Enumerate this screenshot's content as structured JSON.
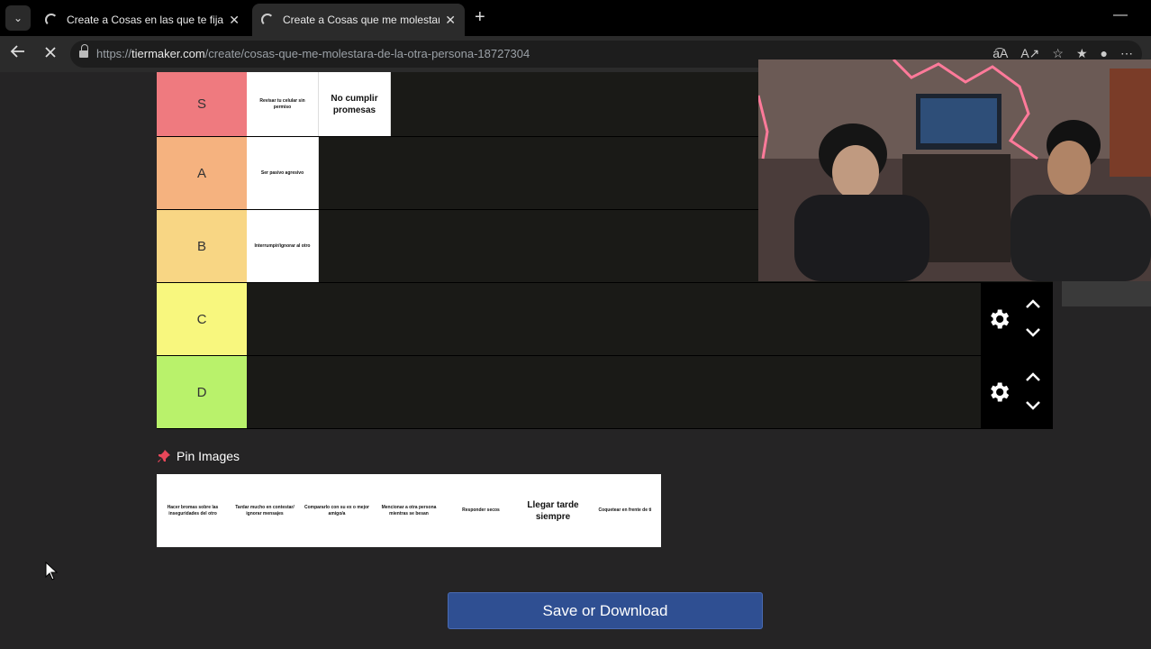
{
  "browser": {
    "tabs": [
      {
        "title": "Create a Cosas en las que te fijas e",
        "close": "✕"
      },
      {
        "title": "Create a Cosas que me molestaría",
        "close": "✕"
      }
    ],
    "new_tab_glyph": "+",
    "minimize_glyph": "—",
    "menu_glyph": "⌄",
    "url_prefix": "https://",
    "url_host": "tiermaker.com",
    "url_path": "/create/cosas-que-me-molestara-de-la-otra-persona-18727304"
  },
  "tiers": [
    {
      "label": "S",
      "color": "#ef7a7f",
      "items": [
        {
          "text": "Revisar tu celular sin permiso",
          "size": "small"
        },
        {
          "text": "No cumplir promesas",
          "size": "big"
        }
      ]
    },
    {
      "label": "A",
      "color": "#f5b27f",
      "items": [
        {
          "text": "Ser pasivo agresivo",
          "size": "small"
        }
      ]
    },
    {
      "label": "B",
      "color": "#f8d684",
      "items": [
        {
          "text": "Interrumpir/ignorar al otro",
          "size": "small"
        }
      ]
    },
    {
      "label": "C",
      "color": "#f8f77e",
      "items": []
    },
    {
      "label": "D",
      "color": "#b9f26b",
      "items": []
    }
  ],
  "pin": {
    "label": "Pin Images",
    "color": "#e8475a"
  },
  "pool": [
    {
      "text": "Hacer bromas sobre las inseguridades del otro",
      "size": "small"
    },
    {
      "text": "Tardar mucho en contestar/ ignorar mensajes",
      "size": "small"
    },
    {
      "text": "Compararlo con su ex o mejor amigo/a",
      "size": "small"
    },
    {
      "text": "Mencionar a otra persona mientras se besan",
      "size": "small"
    },
    {
      "text": "Responder secos",
      "size": "small"
    },
    {
      "text": "Llegar tarde siempre",
      "size": "big"
    },
    {
      "text": "Coquetear en frente de ti",
      "size": "small"
    }
  ],
  "save_button": "Save or Download",
  "colors": {
    "page_bg": "#252425",
    "tier_bg": "#1a1a17",
    "save_bg": "#2f4f92"
  }
}
